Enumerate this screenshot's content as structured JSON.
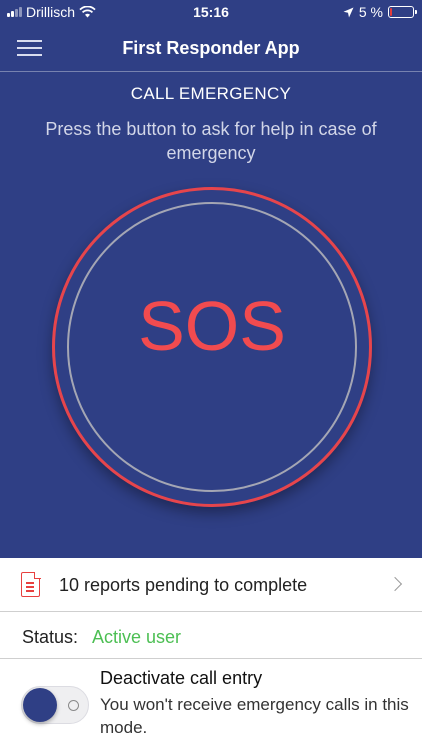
{
  "status_bar": {
    "carrier": "Drillisch",
    "time": "15:16",
    "battery": "5 %",
    "battery_level": 0.05,
    "icons": [
      "signal-icon",
      "wifi-icon",
      "location-arrow-icon",
      "battery-icon"
    ]
  },
  "nav": {
    "title": "First Responder App",
    "menu_icon": "hamburger-menu-icon"
  },
  "emergency": {
    "title": "CALL EMERGENCY",
    "description": "Press the button to ask for help in case of emergency",
    "sos_label": "SOS"
  },
  "reports": {
    "text": "10 reports pending to complete",
    "icon": "document-icon"
  },
  "status": {
    "label": "Status:",
    "value": "Active user"
  },
  "deactivate": {
    "title": "Deactivate call entry",
    "description": "You won't receive emergency calls in this mode.",
    "toggle_on": false
  },
  "colors": {
    "primary": "#2f3f85",
    "sos_red": "#f14b4f",
    "status_green": "#4cbf53"
  }
}
